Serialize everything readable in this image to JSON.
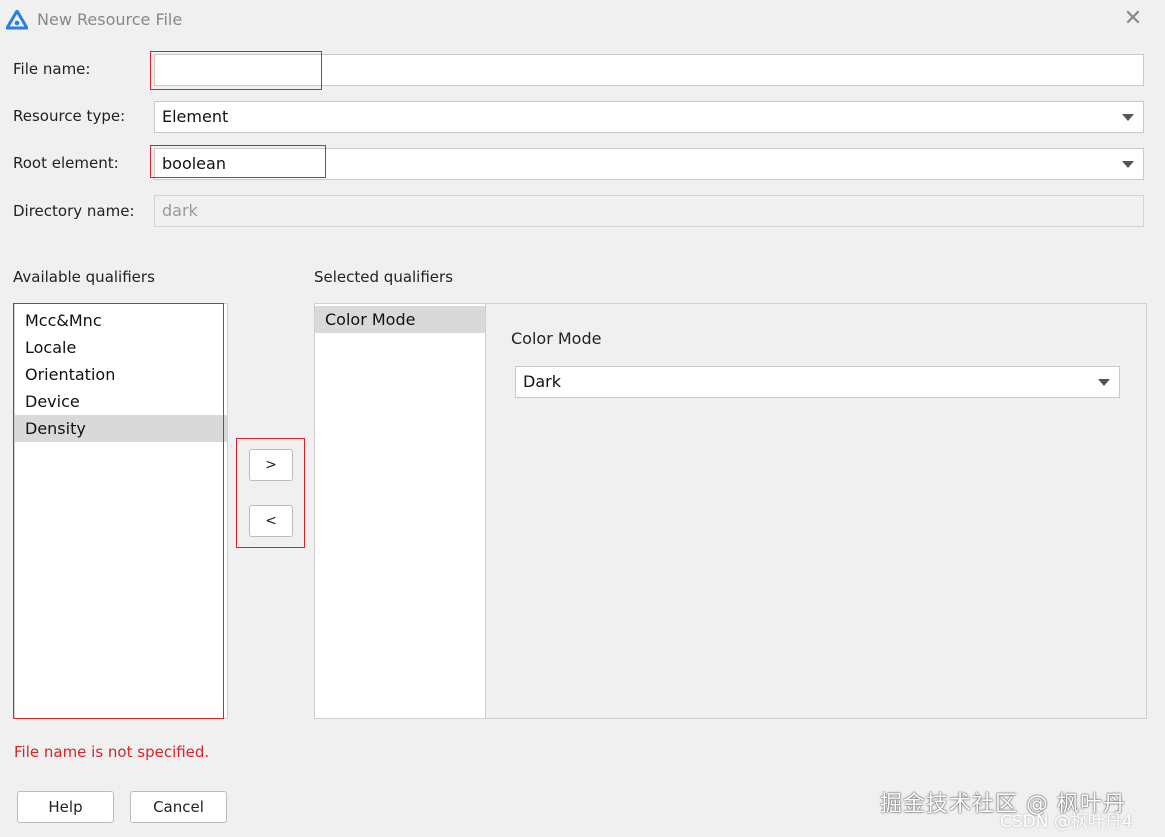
{
  "window": {
    "title": "New Resource File",
    "close_symbol": "✕",
    "icon": "app-logo-icon"
  },
  "form": {
    "file_name_label": "File name:",
    "file_name_value": "",
    "resource_type_label": "Resource type:",
    "resource_type_value": "Element",
    "root_element_label": "Root element:",
    "root_element_value": "boolean",
    "directory_name_label": "Directory name:",
    "directory_name_value": "dark"
  },
  "available": {
    "header": "Available qualifiers",
    "items": [
      "Mcc&Mnc",
      "Locale",
      "Orientation",
      "Device",
      "Density"
    ],
    "selected_index": 4
  },
  "transfer": {
    "add_label": ">",
    "remove_label": "<"
  },
  "selected": {
    "header": "Selected qualifiers",
    "items": [
      "Color Mode"
    ],
    "detail_title": "Color Mode",
    "detail_value": "Dark"
  },
  "status": {
    "error_text": "File name is not specified."
  },
  "buttons": {
    "help_label": "Help",
    "cancel_label": "Cancel"
  },
  "watermark": {
    "line1": "掘金技术社区 @ 枫叶丹",
    "line2": "CSDN @枫叶丹4"
  },
  "colors": {
    "highlight_border": "#d9232b",
    "error_text": "#d9232b",
    "logo": "#2a7de1"
  }
}
